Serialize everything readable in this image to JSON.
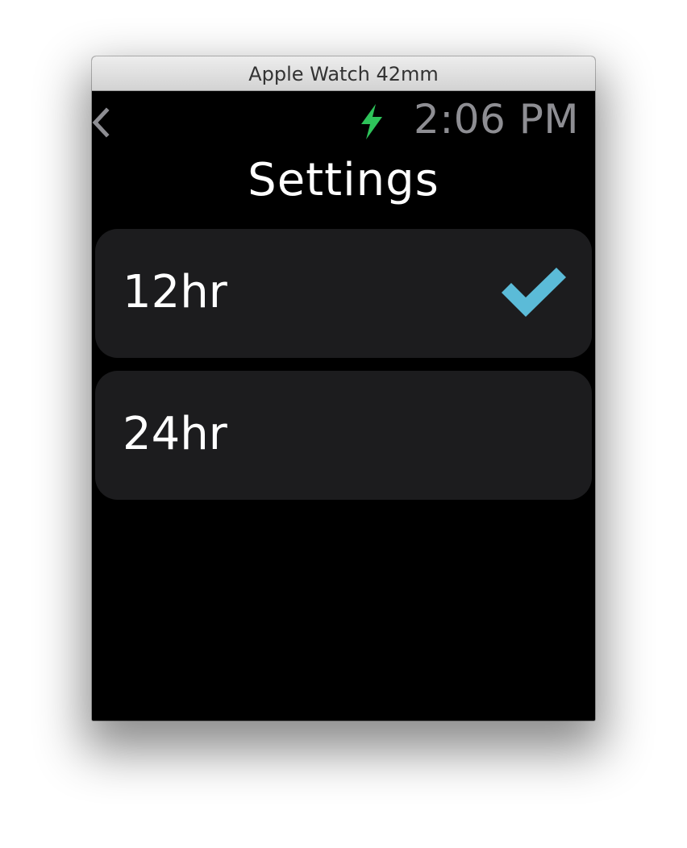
{
  "window": {
    "title": "Apple Watch 42mm"
  },
  "status_bar": {
    "time": "2:06 PM",
    "charging_icon": "bolt-icon",
    "charging_color": "#2ec35a"
  },
  "screen": {
    "title": "Settings",
    "back_icon": "chevron-left-icon"
  },
  "options": [
    {
      "label": "12hr",
      "selected": true
    },
    {
      "label": "24hr",
      "selected": false
    }
  ],
  "colors": {
    "checkmark": "#5bbbd8",
    "row_background": "#1c1c1e",
    "screen_background": "#000000",
    "clock_text": "#8e8e93"
  }
}
